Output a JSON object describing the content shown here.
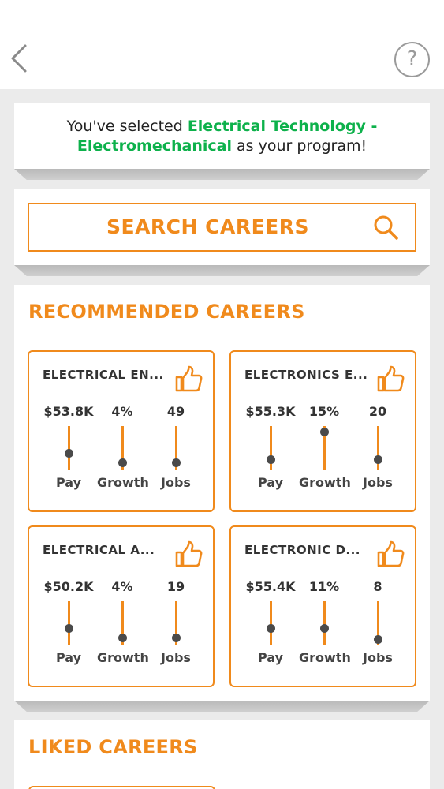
{
  "program": {
    "prefix": "You've selected ",
    "name_line1": "Electrical Technology -",
    "name_line2": "Electromechanical",
    "suffix": " as your program!"
  },
  "search": {
    "label": "SEARCH CAREERS"
  },
  "help": {
    "label": "?"
  },
  "recommended": {
    "title": "RECOMMENDED CAREERS",
    "careers": [
      {
        "name": "ELECTRICAL EN...",
        "metrics": [
          {
            "label": "Pay",
            "value": "$53.8K",
            "level": 0.35
          },
          {
            "label": "Growth",
            "value": "4%",
            "level": 0.1
          },
          {
            "label": "Jobs",
            "value": "49",
            "level": 0.1
          }
        ]
      },
      {
        "name": "ELECTRONICS E...",
        "metrics": [
          {
            "label": "Pay",
            "value": "$55.3K",
            "level": 0.18
          },
          {
            "label": "Growth",
            "value": "15%",
            "level": 0.95
          },
          {
            "label": "Jobs",
            "value": "20",
            "level": 0.18
          }
        ]
      },
      {
        "name": "ELECTRICAL A...",
        "metrics": [
          {
            "label": "Pay",
            "value": "$50.2K",
            "level": 0.35
          },
          {
            "label": "Growth",
            "value": "4%",
            "level": 0.1
          },
          {
            "label": "Jobs",
            "value": "19",
            "level": 0.1
          }
        ]
      },
      {
        "name": "ELECTRONIC D...",
        "metrics": [
          {
            "label": "Pay",
            "value": "$55.4K",
            "level": 0.35
          },
          {
            "label": "Growth",
            "value": "11%",
            "level": 0.35
          },
          {
            "label": "Jobs",
            "value": "8",
            "level": 0.05
          }
        ]
      }
    ]
  },
  "liked": {
    "title": "LIKED CAREERS"
  },
  "colors": {
    "accent": "#f08a1c",
    "program_highlight": "#0db14b",
    "dot": "#4a4a4a",
    "background": "#ebebeb"
  },
  "icons": {
    "back": "chevron-left-icon",
    "help": "question-circle-icon",
    "search": "magnifier-icon",
    "like": "thumbs-up-icon"
  }
}
